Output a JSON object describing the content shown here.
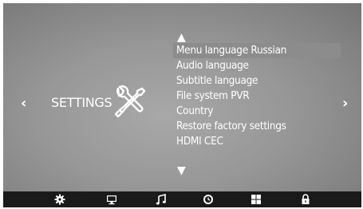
{
  "screen": {
    "title": "SETTINGS",
    "left_nav_glyph": "‹",
    "right_nav_glyph": "›",
    "scroll_up_glyph": "▲",
    "scroll_down_glyph": "▼"
  },
  "menu": {
    "selected_index": 0,
    "items": [
      {
        "label": "Menu language Russian"
      },
      {
        "label": "Audio language"
      },
      {
        "label": "Subtitle language"
      },
      {
        "label": "File system PVR"
      },
      {
        "label": "Country"
      },
      {
        "label": "Restore factory settings"
      },
      {
        "label": "HDMI CEC"
      }
    ]
  },
  "bottom_bar": {
    "icons": [
      "gear-icon",
      "monitor-icon",
      "music-note-icon",
      "clock-icon",
      "grid-icon",
      "lock-icon"
    ]
  },
  "colors": {
    "background": "#979797",
    "selection": "#8c8c8c",
    "bottom_bar": "#1a1a1a",
    "text": "#ffffff"
  }
}
